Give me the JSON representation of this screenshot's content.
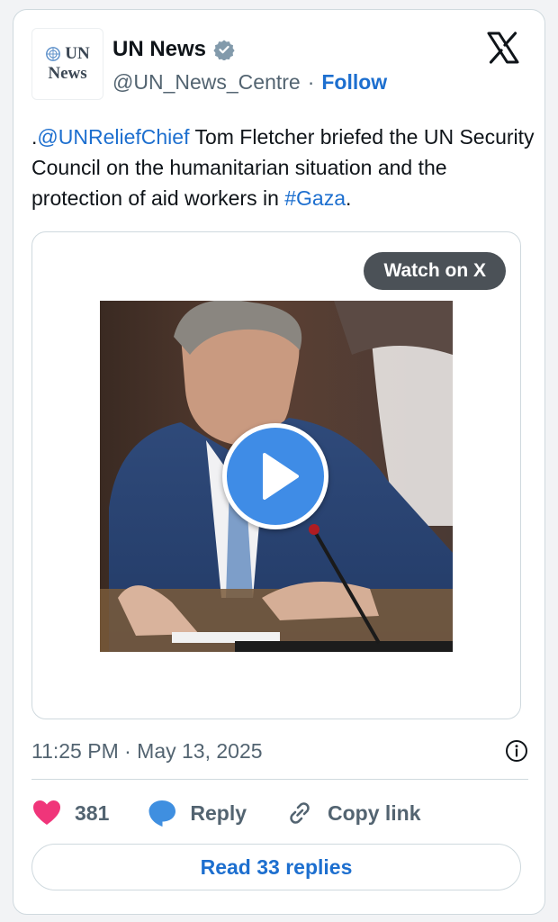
{
  "account": {
    "avatar_line1": "UN",
    "avatar_line2": "News",
    "display_name": "UN News",
    "handle": "@UN_News_Centre",
    "separator": "·",
    "follow_label": "Follow"
  },
  "tweet": {
    "prefix": ".",
    "mention": "@UNReliefChief",
    "text_body": " Tom Fletcher briefed the UN Security Council on the humanitarian situation and the protection of aid workers in ",
    "hashtag": "#Gaza",
    "suffix": "."
  },
  "media": {
    "watch_label": "Watch on X"
  },
  "meta": {
    "timestamp": "11:25 PM · May 13, 2025"
  },
  "actions": {
    "likes": "381",
    "reply_label": "Reply",
    "copy_label": "Copy link"
  },
  "footer": {
    "read_replies_label": "Read 33 replies"
  },
  "colors": {
    "link": "#1d6fcf",
    "like": "#f0357a",
    "reply_icon": "#3f8fe0",
    "play_button": "#3f8ce6",
    "watch_pill": "#4b5157"
  },
  "icons": [
    "un-emblem-icon",
    "verified-badge-icon",
    "x-logo-icon",
    "play-icon",
    "info-icon",
    "heart-icon",
    "reply-bubble-icon",
    "link-icon"
  ]
}
